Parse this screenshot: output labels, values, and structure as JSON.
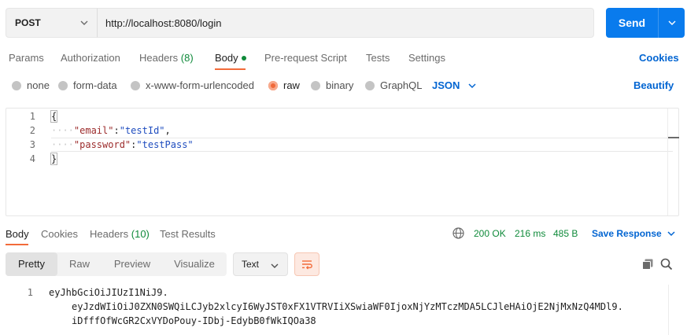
{
  "request": {
    "method": "POST",
    "url": "http://localhost:8080/login",
    "send_label": "Send"
  },
  "request_tabs": {
    "params": "Params",
    "authorization": "Authorization",
    "headers": "Headers",
    "headers_count": "(8)",
    "body": "Body",
    "pre_request_script": "Pre-request Script",
    "tests": "Tests",
    "settings": "Settings",
    "cookies": "Cookies"
  },
  "body_types": {
    "none": "none",
    "form_data": "form-data",
    "urlencoded": "x-www-form-urlencoded",
    "raw": "raw",
    "binary": "binary",
    "graphql": "GraphQL",
    "language": "JSON",
    "beautify": "Beautify",
    "selected": "raw"
  },
  "editor": {
    "lines": [
      {
        "num": "1",
        "open": "{"
      },
      {
        "num": "2",
        "indent": "····",
        "key": "\"email\"",
        "sep": ":",
        "value": "\"testId\"",
        "trail": ","
      },
      {
        "num": "3",
        "indent": "····",
        "key": "\"password\"",
        "sep": ":",
        "value": "\"testPass\"",
        "trail": ""
      },
      {
        "num": "4",
        "close": "}"
      }
    ]
  },
  "response_tabs": {
    "body": "Body",
    "cookies": "Cookies",
    "headers": "Headers",
    "headers_count": "(10)",
    "test_results": "Test Results",
    "status": "200 OK",
    "time": "216 ms",
    "size": "485 B",
    "save_response": "Save Response"
  },
  "response_toolbar": {
    "pretty": "Pretty",
    "raw": "Raw",
    "preview": "Preview",
    "visualize": "Visualize",
    "format": "Text",
    "selected": "Pretty"
  },
  "response_body": {
    "line_number": "1",
    "lines": [
      "eyJhbGciOiJIUzI1NiJ9.",
      "eyJzdWIiOiJ0ZXN0SWQiLCJyb2xlcyI6WyJST0xFX1VTRVIiXSwiaWF0IjoxNjYzMTczMDA5LCJleHAiOjE2NjMxNzQ4MDl9.",
      "iDfffOfWcGR2CxVYDoPouy-IDbj-EdybB0fWkIQOa38"
    ]
  },
  "colors": {
    "accent_orange": "#f26b3a",
    "send_blue": "#097bed",
    "link_blue": "#0265d2",
    "status_green": "#0f8a3a"
  },
  "icons": [
    "chevron-down-icon",
    "globe-icon",
    "wrap-lines-icon",
    "copy-icon",
    "search-icon"
  ]
}
